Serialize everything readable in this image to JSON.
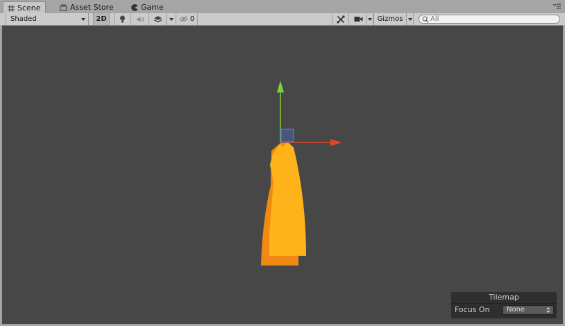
{
  "tabs": [
    {
      "label": "Scene",
      "icon": "grid-icon",
      "active": true
    },
    {
      "label": "Asset Store",
      "icon": "store-icon",
      "active": false
    },
    {
      "label": "Game",
      "icon": "pacman-icon",
      "active": false
    }
  ],
  "toolbar": {
    "draw_mode": "Shaded",
    "mode_2d": "2D",
    "hidden_count": "0",
    "gizmos": "Gizmos",
    "search_placeholder": "All"
  },
  "overlay": {
    "title": "Tilemap",
    "focus_label": "Focus On",
    "focus_value": "None"
  },
  "colors": {
    "scene_bg": "#474747",
    "y_axis": "#7fd13b",
    "x_axis": "#e0472a",
    "center_handle": "#4a73d8",
    "sprite_back": "#f08a12",
    "sprite_front": "#ffb31a"
  }
}
